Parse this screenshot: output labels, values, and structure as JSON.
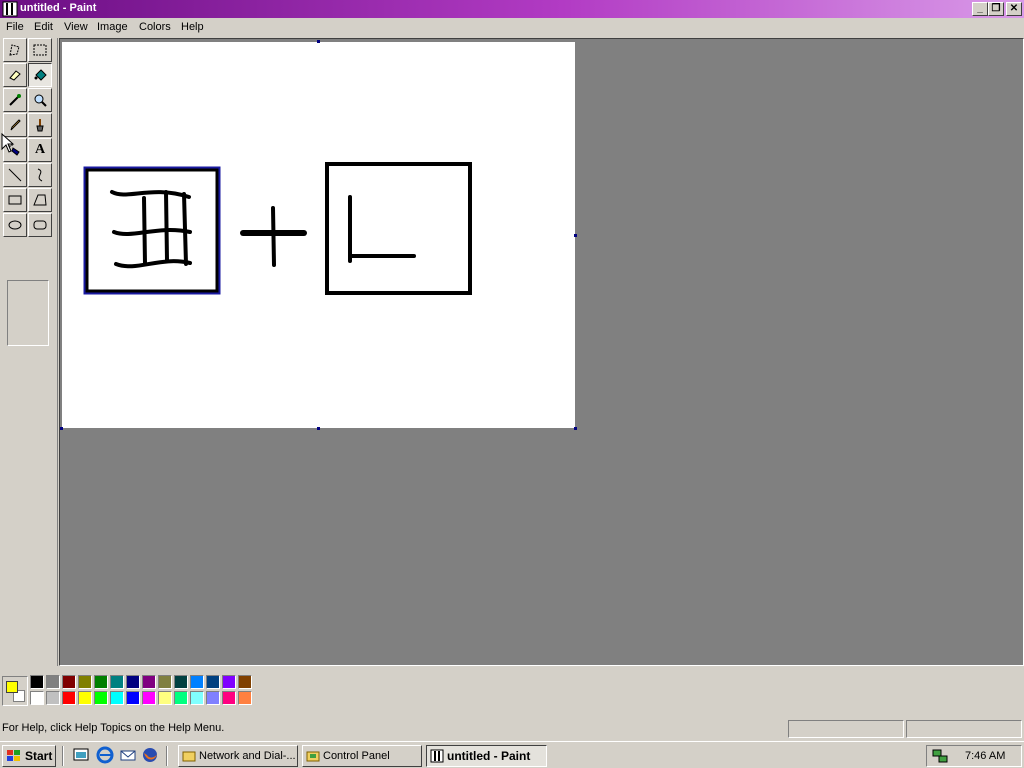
{
  "window": {
    "title": "untitled - Paint"
  },
  "window_controls": {
    "minimize": "_",
    "maximize": "❐",
    "close": "✕"
  },
  "menu": [
    "File",
    "Edit",
    "View",
    "Image",
    "Colors",
    "Help"
  ],
  "tools": [
    {
      "name": "free-form-select-tool",
      "icon": "free-form-select-icon"
    },
    {
      "name": "select-tool",
      "icon": "rect-select-icon"
    },
    {
      "name": "eraser-tool",
      "icon": "eraser-icon"
    },
    {
      "name": "fill-tool",
      "icon": "paint-bucket-icon",
      "pressed": true
    },
    {
      "name": "pick-color-tool",
      "icon": "eyedropper-icon"
    },
    {
      "name": "magnifier-tool",
      "icon": "magnifier-icon"
    },
    {
      "name": "pencil-tool",
      "icon": "pencil-icon"
    },
    {
      "name": "brush-tool",
      "icon": "brush-icon"
    },
    {
      "name": "airbrush-tool",
      "icon": "airbrush-icon"
    },
    {
      "name": "text-tool",
      "icon": "text-icon",
      "label": "A"
    },
    {
      "name": "line-tool",
      "icon": "line-icon"
    },
    {
      "name": "curve-tool",
      "icon": "curve-icon"
    },
    {
      "name": "rectangle-tool",
      "icon": "rectangle-icon"
    },
    {
      "name": "polygon-tool",
      "icon": "polygon-icon"
    },
    {
      "name": "ellipse-tool",
      "icon": "ellipse-icon"
    },
    {
      "name": "rounded-rectangle-tool",
      "icon": "rounded-rectangle-icon"
    }
  ],
  "colors": {
    "foreground": "#ffff00",
    "background": "#ffffff",
    "palette_top": [
      "#000000",
      "#808080",
      "#800000",
      "#808000",
      "#008000",
      "#008080",
      "#000080",
      "#800080",
      "#808040",
      "#004040",
      "#0080ff",
      "#004080",
      "#8000ff",
      "#804000"
    ],
    "palette_bottom": [
      "#ffffff",
      "#c0c0c0",
      "#ff0000",
      "#ffff00",
      "#00ff00",
      "#00ffff",
      "#0000ff",
      "#ff00ff",
      "#ffff80",
      "#00ff80",
      "#80ffff",
      "#8080ff",
      "#ff0080",
      "#ff8040"
    ]
  },
  "status": {
    "help_text": "For Help, click Help Topics on the Help Menu."
  },
  "taskbar": {
    "start_label": "Start",
    "quick_launch": [
      "show-desktop-icon",
      "internet-explorer-icon",
      "outlook-express-icon",
      "firefox-icon"
    ],
    "tasks": [
      {
        "label": "Network and Dial-...",
        "icon": "network-folder-icon",
        "active": false
      },
      {
        "label": "Control Panel",
        "icon": "control-panel-icon",
        "active": false
      },
      {
        "label": "untitled - Paint",
        "icon": "paint-icon",
        "active": true
      }
    ],
    "clock": "7:46 AM",
    "tray_icon": "network-connection-icon"
  }
}
